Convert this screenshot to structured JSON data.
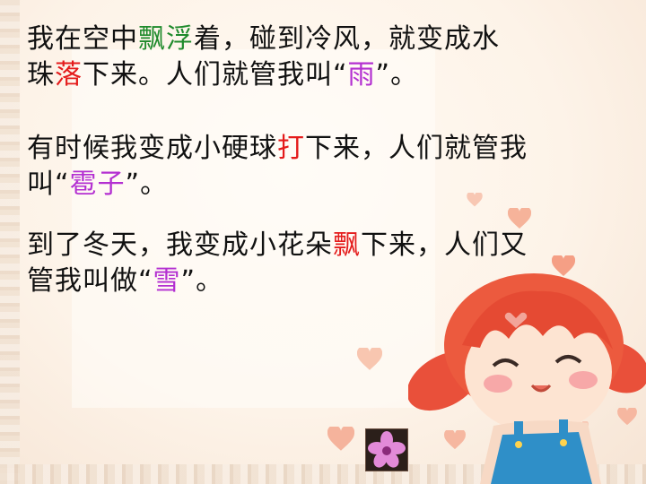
{
  "paragraphs": [
    {
      "line1": [
        "我在空中",
        "飘浮",
        "着，碰到冷风，就变成水"
      ],
      "line2": [
        "珠",
        "落",
        "下来。人们就管我叫“",
        "雨",
        "”。"
      ]
    },
    {
      "line1": [
        "有时候我变成小硬球",
        "打",
        "下来，人们就管我"
      ],
      "line2": [
        "叫“",
        "雹子",
        "”。"
      ]
    },
    {
      "line1": [
        "到了冬天，我变成小花朵",
        "飘",
        "下来，人们又"
      ],
      "line2": [
        "管我叫做“",
        "雪",
        "”。"
      ]
    }
  ],
  "colors": {
    "highlight_green": "#1f8a2b",
    "highlight_red": "#e41b1b",
    "highlight_purple": "#b32fd1",
    "text": "#111111"
  },
  "decorations": [
    "cartoon-girl-illustration",
    "heart-icon",
    "flower-thumbnail"
  ]
}
